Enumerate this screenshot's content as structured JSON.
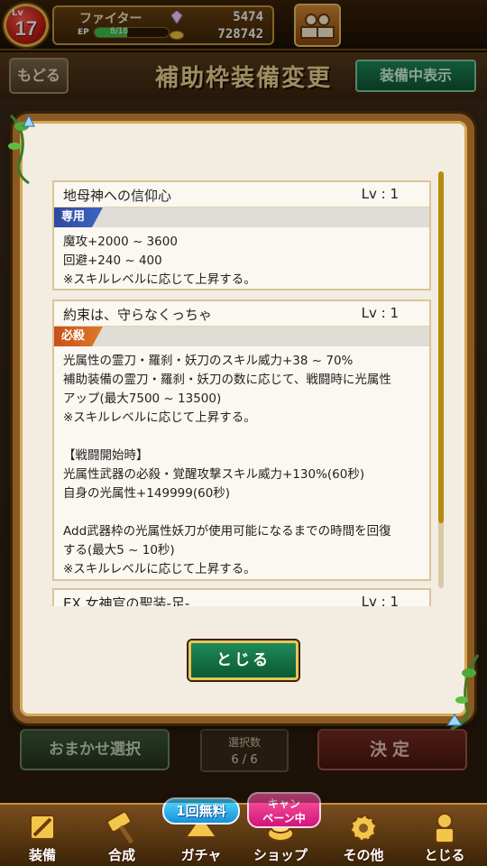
{
  "status": {
    "level_tag": "Lv",
    "level": "17",
    "player_name": "ファイター",
    "ep_label": "EP",
    "ep_value": "8/18",
    "ep_fraction": 0.44,
    "gems": "5474",
    "coins": "728742"
  },
  "header": {
    "back_label": "もどる",
    "title": "補助枠装備変更",
    "equipped_view_label": "装備中表示"
  },
  "skills": [
    {
      "name": "地母神への信仰心",
      "level": "Lv : 1",
      "tag": "専用",
      "lines": [
        "魔攻+2000 ~ 3600",
        "回避+240 ~ 400",
        "※スキルレベルに応じて上昇する。"
      ]
    },
    {
      "name": "約束は、守らなくっちゃ",
      "level": "Lv : 1",
      "tag": "必殺",
      "lines": [
        "光属性の霊刀・羅刹・妖刀のスキル威力+38 ~ 70%",
        "補助装備の霊刀・羅刹・妖刀の数に応じて、戦闘時に光属性",
        "アップ(最大7500 ~ 13500)",
        "※スキルレベルに応じて上昇する。",
        "",
        "【戦闘開始時】",
        "光属性武器の必殺・覚醒攻撃スキル威力+130%(60秒)",
        "自身の光属性+149999(60秒)",
        "",
        "Add武器枠の光属性妖刀が使用可能になるまでの時間を回復",
        "する(最大5 ~ 10秒)",
        "※スキルレベルに応じて上昇する。"
      ]
    },
    {
      "name": "EX 女神官の聖装-足-",
      "level": "Lv : 1"
    }
  ],
  "modal": {
    "close_label": "とじる"
  },
  "footer": {
    "omakase_label": "おまかせ選択",
    "select_count_label": "選択数",
    "select_count_value": "6 / 6",
    "decide_label": "決定"
  },
  "nav": {
    "items": [
      {
        "label": "装備",
        "icon": "sword-icon"
      },
      {
        "label": "合成",
        "icon": "hammer-icon"
      },
      {
        "label": "ガチャ",
        "icon": "gacha-icon"
      },
      {
        "label": "ショップ",
        "icon": "shop-icon"
      },
      {
        "label": "その他",
        "icon": "gear-icon"
      },
      {
        "label": "とじる",
        "icon": "guardian-statue-icon"
      }
    ],
    "free_badge": "1回無料",
    "campaign_badge_line1": "キャン",
    "campaign_badge_line2": "ペーン中"
  }
}
